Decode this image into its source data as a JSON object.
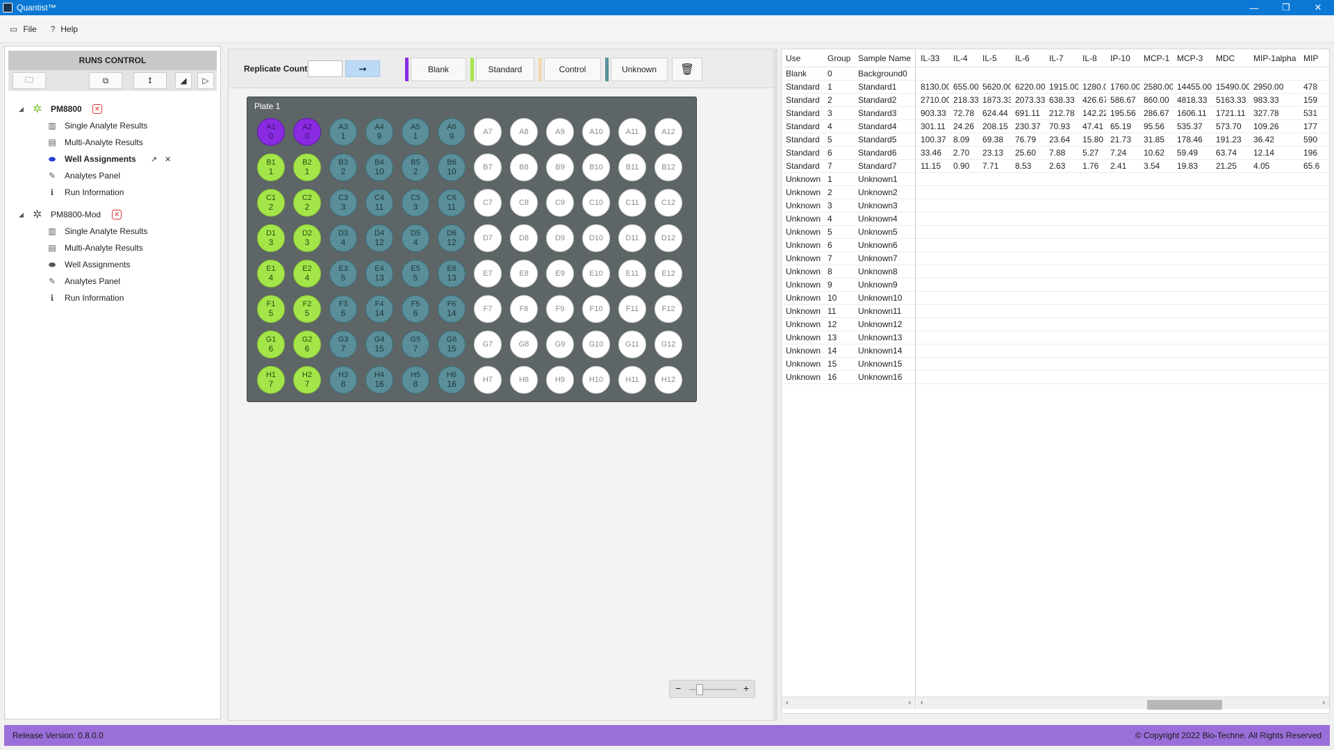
{
  "window": {
    "title": "Quantist™",
    "controls": [
      "—",
      "❐",
      "✕"
    ]
  },
  "menu": [
    {
      "label": "File",
      "icon": "file-icon"
    },
    {
      "label": "Help",
      "icon": "help-icon"
    }
  ],
  "sidebar": {
    "header": "RUNS CONTROL",
    "runs": [
      {
        "label": "PM8800",
        "expanded": true,
        "children": [
          {
            "label": "Single Analyte Results",
            "icon": "bar-chart-icon",
            "active": false
          },
          {
            "label": "Multi-Analyte Results",
            "icon": "list-icon",
            "active": false
          },
          {
            "label": "Well Assignments",
            "icon": "plate-icon",
            "active": true
          },
          {
            "label": "Analytes Panel",
            "icon": "pipette-icon",
            "active": false
          },
          {
            "label": "Run Information",
            "icon": "info-icon",
            "active": false
          }
        ]
      },
      {
        "label": "PM8800-Mod",
        "expanded": true,
        "children": [
          {
            "label": "Single Analyte Results",
            "icon": "bar-chart-icon",
            "active": false
          },
          {
            "label": "Multi-Analyte Results",
            "icon": "list-icon",
            "active": false
          },
          {
            "label": "Well Assignments",
            "icon": "plate-icon",
            "active": false
          },
          {
            "label": "Analytes Panel",
            "icon": "pipette-icon",
            "active": false
          },
          {
            "label": "Run Information",
            "icon": "info-icon",
            "active": false
          }
        ]
      }
    ]
  },
  "assign_bar": {
    "replicate_label": "Replicate Count",
    "replicate_value": "",
    "types": [
      {
        "label": "Blank",
        "color": "#8a2be2"
      },
      {
        "label": "Standard",
        "color": "#a4e64a"
      },
      {
        "label": "Control",
        "color": "#f3d9b1"
      },
      {
        "label": "Unknown",
        "color": "#5a8f9a"
      }
    ]
  },
  "plate": {
    "title": "Plate 1",
    "rows": [
      "A",
      "B",
      "C",
      "D",
      "E",
      "F",
      "G",
      "H"
    ],
    "columns": 12,
    "colors": {
      "blank": "#8a2be2",
      "standard": "#a4e64a",
      "unknown": "#5a8f9a",
      "empty": "#ffffff"
    },
    "assignments": {
      "col1": {
        "type": "blank_standard",
        "groups": [
          "0",
          "1",
          "2",
          "3",
          "4",
          "5",
          "6",
          "7"
        ]
      },
      "col2": {
        "type": "blank_standard",
        "groups": [
          "0",
          "1",
          "2",
          "3",
          "4",
          "5",
          "6",
          "7"
        ]
      },
      "col3": {
        "type": "unknown",
        "groups": [
          "1",
          "2",
          "3",
          "4",
          "5",
          "6",
          "7",
          "8"
        ]
      },
      "col4": {
        "type": "unknown",
        "groups": [
          "9",
          "10",
          "11",
          "12",
          "13",
          "14",
          "15",
          "16"
        ]
      },
      "col5": {
        "type": "unknown",
        "groups": [
          "1",
          "2",
          "3",
          "4",
          "5",
          "6",
          "7",
          "8"
        ]
      },
      "col6": {
        "type": "unknown",
        "groups": [
          "9",
          "10",
          "11",
          "12",
          "13",
          "14",
          "15",
          "16"
        ]
      }
    }
  },
  "samples": {
    "headers": [
      "Use",
      "Group",
      "Sample Name"
    ],
    "rows": [
      [
        "Blank",
        "0",
        "Background0"
      ],
      [
        "Standard",
        "1",
        "Standard1"
      ],
      [
        "Standard",
        "2",
        "Standard2"
      ],
      [
        "Standard",
        "3",
        "Standard3"
      ],
      [
        "Standard",
        "4",
        "Standard4"
      ],
      [
        "Standard",
        "5",
        "Standard5"
      ],
      [
        "Standard",
        "6",
        "Standard6"
      ],
      [
        "Standard",
        "7",
        "Standard7"
      ],
      [
        "Unknown",
        "1",
        "Unknown1"
      ],
      [
        "Unknown",
        "2",
        "Unknown2"
      ],
      [
        "Unknown",
        "3",
        "Unknown3"
      ],
      [
        "Unknown",
        "4",
        "Unknown4"
      ],
      [
        "Unknown",
        "5",
        "Unknown5"
      ],
      [
        "Unknown",
        "6",
        "Unknown6"
      ],
      [
        "Unknown",
        "7",
        "Unknown7"
      ],
      [
        "Unknown",
        "8",
        "Unknown8"
      ],
      [
        "Unknown",
        "9",
        "Unknown9"
      ],
      [
        "Unknown",
        "10",
        "Unknown10"
      ],
      [
        "Unknown",
        "11",
        "Unknown11"
      ],
      [
        "Unknown",
        "12",
        "Unknown12"
      ],
      [
        "Unknown",
        "13",
        "Unknown13"
      ],
      [
        "Unknown",
        "14",
        "Unknown14"
      ],
      [
        "Unknown",
        "15",
        "Unknown15"
      ],
      [
        "Unknown",
        "16",
        "Unknown16"
      ]
    ]
  },
  "analytes": {
    "headers": [
      "IL-33",
      "IL-4",
      "IL-5",
      "IL-6",
      "IL-7",
      "IL-8",
      "IP-10",
      "MCP-1",
      "MCP-3",
      "MDC",
      "MIP-1alpha",
      "MIP"
    ],
    "rows": [
      [
        "",
        "",
        "",
        "",
        "",
        "",
        "",
        "",
        "",
        "",
        "",
        ""
      ],
      [
        "8130.00",
        "655.00",
        "5620.00",
        "6220.00",
        "1915.00",
        "1280.00",
        "1760.00",
        "2580.00",
        "14455.00",
        "15490.00",
        "2950.00",
        "478"
      ],
      [
        "2710.00",
        "218.33",
        "1873.33",
        "2073.33",
        "638.33",
        "426.67",
        "586.67",
        "860.00",
        "4818.33",
        "5163.33",
        "983.33",
        "159"
      ],
      [
        "903.33",
        "72.78",
        "624.44",
        "691.11",
        "212.78",
        "142.22",
        "195.56",
        "286.67",
        "1606.11",
        "1721.11",
        "327.78",
        "531"
      ],
      [
        "301.11",
        "24.26",
        "208.15",
        "230.37",
        "70.93",
        "47.41",
        "65.19",
        "95.56",
        "535.37",
        "573.70",
        "109.26",
        "177"
      ],
      [
        "100.37",
        "8.09",
        "69.38",
        "76.79",
        "23.64",
        "15.80",
        "21.73",
        "31.85",
        "178.46",
        "191.23",
        "36.42",
        "590"
      ],
      [
        "33.46",
        "2.70",
        "23.13",
        "25.60",
        "7.88",
        "5.27",
        "7.24",
        "10.62",
        "59.49",
        "63.74",
        "12.14",
        "196"
      ],
      [
        "11.15",
        "0.90",
        "7.71",
        "8.53",
        "2.63",
        "1.76",
        "2.41",
        "3.54",
        "19.83",
        "21.25",
        "4.05",
        "65.6"
      ]
    ]
  },
  "zoom": {
    "minus": "−",
    "plus": "+"
  },
  "status": {
    "version": "Release Version: 0.8.0.0",
    "copyright": "© Copyright 2022 Bio-Techne. All Rights Reserved"
  }
}
